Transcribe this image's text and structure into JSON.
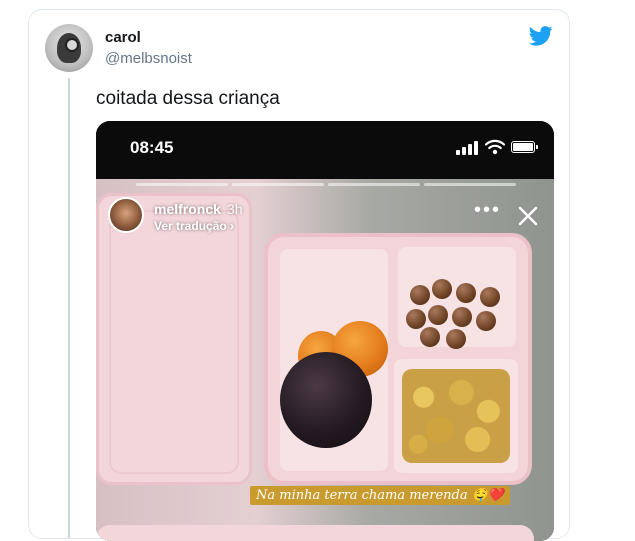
{
  "tweet": {
    "display_name": "carol",
    "handle": "@melbsnoist",
    "text": "coitada dessa criança",
    "brand_icon": "twitter-bird-icon",
    "brand_color": "#1da1f2"
  },
  "story": {
    "status_time": "08:45",
    "username": "melfronck",
    "age": "3h",
    "translate_label": "Ver tradução",
    "caption": "Na minha terra chama merenda 🤤❤️",
    "icons": [
      "signal-icon",
      "wifi-icon",
      "battery-icon",
      "more-icon",
      "close-icon"
    ]
  }
}
